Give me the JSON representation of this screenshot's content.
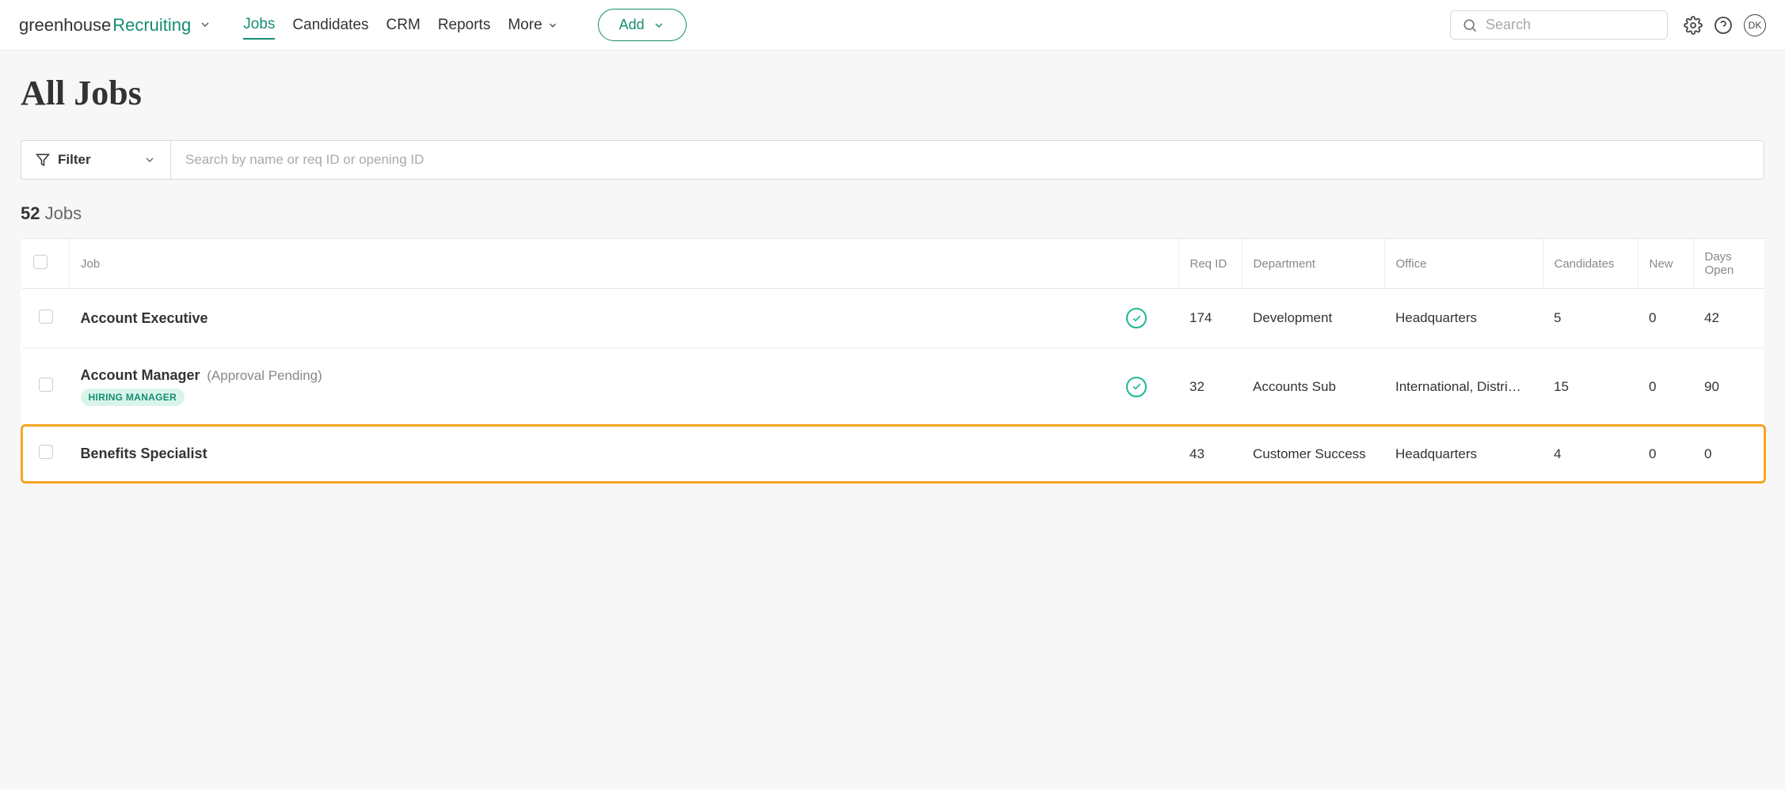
{
  "brand": {
    "part1": "greenhouse",
    "part2": "Recruiting"
  },
  "nav": {
    "jobs": "Jobs",
    "candidates": "Candidates",
    "crm": "CRM",
    "reports": "Reports",
    "more": "More"
  },
  "add_button": "Add",
  "search_placeholder": "Search",
  "avatar_initials": "DK",
  "page_title": "All Jobs",
  "filter_label": "Filter",
  "filter_search_placeholder": "Search by name or req ID or opening ID",
  "job_count": "52",
  "job_count_label": "Jobs",
  "columns": {
    "job": "Job",
    "req_id": "Req ID",
    "department": "Department",
    "office": "Office",
    "candidates": "Candidates",
    "new": "New",
    "days_open": "Days Open"
  },
  "rows": [
    {
      "name": "Account Executive",
      "status_note": "",
      "role_badge": "",
      "has_check": true,
      "req_id": "174",
      "department": "Development",
      "office": "Headquarters",
      "candidates": "5",
      "new": "0",
      "days_open": "42",
      "highlighted": false
    },
    {
      "name": "Account Manager",
      "status_note": "(Approval Pending)",
      "role_badge": "HIRING MANAGER",
      "has_check": true,
      "req_id": "32",
      "department": "Accounts Sub",
      "office": "International, Distri…",
      "candidates": "15",
      "new": "0",
      "days_open": "90",
      "highlighted": false
    },
    {
      "name": "Benefits Specialist",
      "status_note": "",
      "role_badge": "",
      "has_check": false,
      "req_id": "43",
      "department": "Customer Success",
      "office": "Headquarters",
      "candidates": "4",
      "new": "0",
      "days_open": "0",
      "highlighted": true
    }
  ]
}
